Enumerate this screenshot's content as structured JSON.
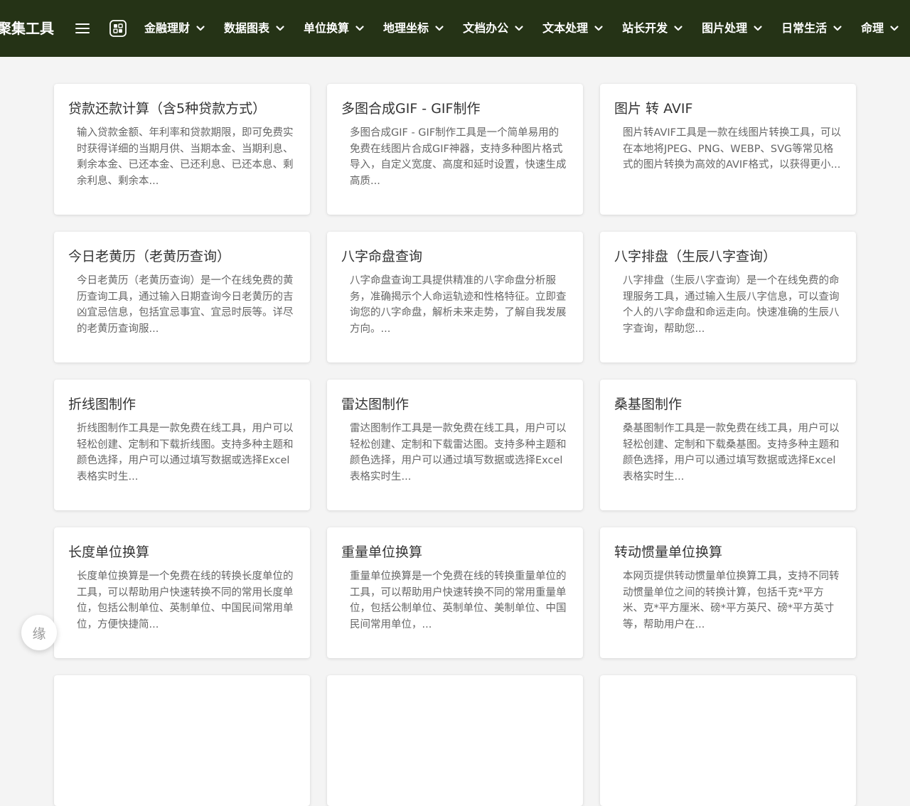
{
  "brand": {
    "title": "聚集工具"
  },
  "nav": {
    "items": [
      {
        "label": "金融理财"
      },
      {
        "label": "数据图表"
      },
      {
        "label": "单位换算"
      },
      {
        "label": "地理坐标"
      },
      {
        "label": "文档办公"
      },
      {
        "label": "文本处理"
      },
      {
        "label": "站长开发"
      },
      {
        "label": "图片处理"
      },
      {
        "label": "日常生活"
      },
      {
        "label": "命理"
      }
    ]
  },
  "cards": [
    {
      "title": "贷款还款计算（含5种贷款方式）",
      "desc": "输入贷款金额、年利率和贷款期限，即可免费实时获得详细的当期月供、当期本金、当期利息、剩余本金、已还本金、已还利息、已还本息、剩余利息、剩余本..."
    },
    {
      "title": "多图合成GIF - GIF制作",
      "desc": "多图合成GIF - GIF制作工具是一个简单易用的免费在线图片合成GIF神器，支持多种图片格式导入，自定义宽度、高度和延时设置，快速生成高质..."
    },
    {
      "title": "图片 转 AVIF",
      "desc": "图片转AVIF工具是一款在线图片转换工具，可以在本地将JPEG、PNG、WEBP、SVG等常见格式的图片转换为高效的AVIF格式，以获得更小..."
    },
    {
      "title": "今日老黄历（老黄历查询）",
      "desc": "今日老黄历（老黄历查询）是一个在线免费的黄历查询工具，通过输入日期查询今日老黄历的吉凶宜忌信息，包括宜忌事宜、宜忌时辰等。详尽的老黄历查询服..."
    },
    {
      "title": "八字命盘查询",
      "desc": "八字命盘查询工具提供精准的八字命盘分析服务，准确揭示个人命运轨迹和性格特征。立即查询您的八字命盘，解析未来走势，了解自我发展方向。..."
    },
    {
      "title": "八字排盘（生辰八字查询）",
      "desc": "八字排盘（生辰八字查询）是一个在线免费的命理服务工具，通过输入生辰八字信息，可以查询个人的八字命盘和命运走向。快速准确的生辰八字查询，帮助您..."
    },
    {
      "title": "折线图制作",
      "desc": "折线图制作工具是一款免费在线工具，用户可以轻松创建、定制和下载折线图。支持多种主题和颜色选择，用户可以通过填写数据或选择Excel表格实时生..."
    },
    {
      "title": "雷达图制作",
      "desc": "雷达图制作工具是一款免费在线工具，用户可以轻松创建、定制和下载雷达图。支持多种主题和颜色选择，用户可以通过填写数据或选择Excel表格实时生..."
    },
    {
      "title": "桑基图制作",
      "desc": "桑基图制作工具是一款免费在线工具，用户可以轻松创建、定制和下载桑基图。支持多种主题和颜色选择，用户可以通过填写数据或选择Excel表格实时生..."
    },
    {
      "title": "长度单位换算",
      "desc": "长度单位换算是一个免费在线的转换长度单位的工具，可以帮助用户快速转换不同的常用长度单位，包括公制单位、英制单位、中国民间常用单位，方便快捷简..."
    },
    {
      "title": "重量单位换算",
      "desc": "重量单位换算是一个免费在线的转换重量单位的工具，可以帮助用户快速转换不同的常用重量单位，包括公制单位、英制单位、美制单位、中国民间常用单位，..."
    },
    {
      "title": "转动惯量单位换算",
      "desc": "本网页提供转动惯量单位换算工具，支持不同转动惯量单位之间的转换计算，包括千克*平方米、克*平方厘米、磅*平方英尺、磅*平方英寸等，帮助用户在..."
    },
    {
      "title": "",
      "desc": ""
    },
    {
      "title": "",
      "desc": ""
    },
    {
      "title": "",
      "desc": ""
    }
  ],
  "float_button": {
    "label": "缘"
  },
  "colors": {
    "nav_background": "#253316",
    "page_background": "#f4f4f4",
    "card_background": "#ffffff"
  },
  "icons": {
    "menu": "hamburger-menu-icon",
    "logo": "tool-logo-icon",
    "dropdown": "chevron-down-icon"
  }
}
